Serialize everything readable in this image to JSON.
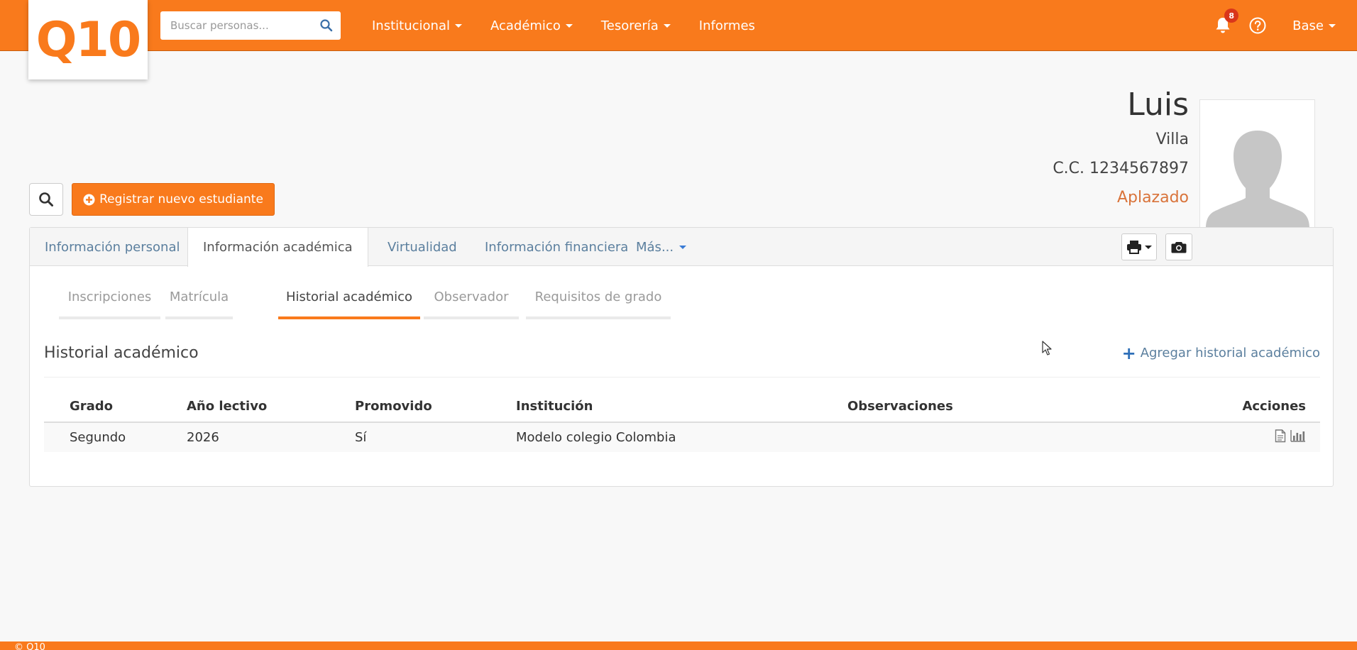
{
  "brand": {
    "logo_text": "Q10",
    "accent": "#f97a1c"
  },
  "navbar": {
    "search_placeholder": "Buscar personas...",
    "menu": [
      {
        "label": "Institucional",
        "dropdown": true
      },
      {
        "label": "Académico",
        "dropdown": true
      },
      {
        "label": "Tesorería",
        "dropdown": true
      },
      {
        "label": "Informes",
        "dropdown": false
      }
    ],
    "notifications_count": "8",
    "user_label": "Base"
  },
  "profile": {
    "first_name": "Luis",
    "last_name": "Villa",
    "document": "C.C. 1234567897",
    "status": "Aplazado",
    "status_color": "#d9733a"
  },
  "actions": {
    "register_label": "Registrar nuevo estudiante"
  },
  "tabs": [
    {
      "label": "Información personal",
      "active": false
    },
    {
      "label": "Información académica",
      "active": true
    },
    {
      "label": "Virtualidad",
      "active": false
    },
    {
      "label": "Información financiera",
      "active": false
    },
    {
      "label": "Más...",
      "active": false
    }
  ],
  "subtabs": [
    {
      "label": "Inscripciones",
      "active": false
    },
    {
      "label": "Matrícula",
      "active": false
    },
    {
      "label": "Historial académico",
      "active": true
    },
    {
      "label": "Observador",
      "active": false
    },
    {
      "label": "Requisitos de grado",
      "active": false
    }
  ],
  "history": {
    "title": "Historial académico",
    "add_label": "Agregar historial académico",
    "columns": [
      "Grado",
      "Año lectivo",
      "Promovido",
      "Institución",
      "Observaciones",
      "Acciones"
    ],
    "rows": [
      [
        "Segundo",
        "2026",
        "Sí",
        "Modelo colegio Colombia",
        ""
      ]
    ]
  },
  "footer": {
    "text": "© Q10"
  }
}
